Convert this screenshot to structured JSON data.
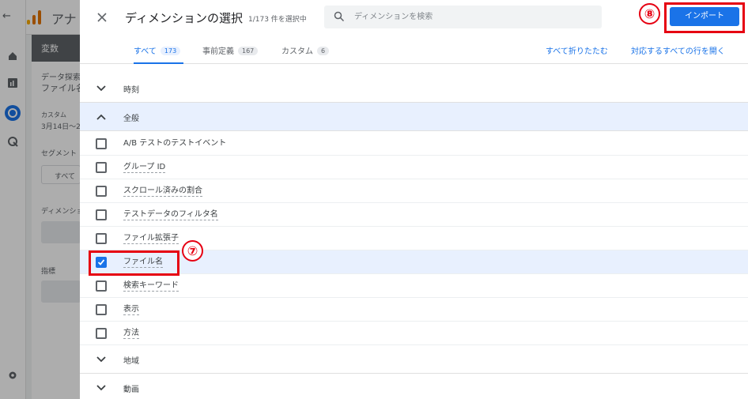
{
  "background": {
    "app_title": "アナ",
    "panel_header": "変数",
    "exploration_name": "データ探索",
    "exploration_sub": "ファイル名",
    "date_label": "カスタム",
    "date_value": "3月14日〜2",
    "segments_label": "セグメント",
    "segment_chip": "すべて",
    "dimensions_label": "ディメンション",
    "metrics_label": "指標"
  },
  "dialog": {
    "title": "ディメンションの選択",
    "selection_count": "1/173 件を選択中",
    "search_placeholder": "ディメンションを検索",
    "import_button": "インポート",
    "tabs": [
      {
        "label": "すべて",
        "count": "173"
      },
      {
        "label": "事前定義",
        "count": "167"
      },
      {
        "label": "カスタム",
        "count": "6"
      }
    ],
    "collapse_all": "すべて折りたたむ",
    "expand_all": "対応するすべての行を開く",
    "groups": {
      "time": "時刻",
      "general": "全般",
      "region": "地域",
      "video": "動画"
    },
    "items": [
      {
        "label": "A/B テストのテストイベント",
        "checked": false
      },
      {
        "label": "グループ ID",
        "checked": false
      },
      {
        "label": "スクロール済みの割合",
        "checked": false
      },
      {
        "label": "テストデータのフィルタ名",
        "checked": false
      },
      {
        "label": "ファイル拡張子",
        "checked": false
      },
      {
        "label": "ファイル名",
        "checked": true
      },
      {
        "label": "検索キーワード",
        "checked": false
      },
      {
        "label": "表示",
        "checked": false
      },
      {
        "label": "方法",
        "checked": false
      }
    ]
  },
  "annotations": {
    "step_7": "⑦",
    "step_8": "⑧"
  },
  "colors": {
    "accent": "#1a73e8",
    "annotation_red": "#e60012",
    "selected_row": "#e8f0fe"
  }
}
